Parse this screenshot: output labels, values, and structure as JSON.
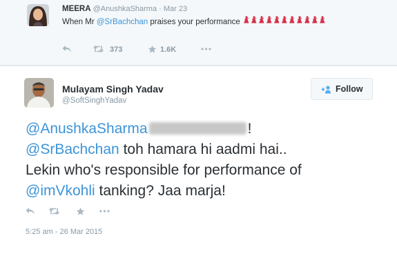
{
  "parent_tweet": {
    "name": "MEERA",
    "handle": "@AnushkaSharma",
    "separator": "·",
    "date": "Mar 23",
    "text_before": "When Mr ",
    "mention": "@SrBachchan",
    "text_after": " praises your performance",
    "emoji_count": 11,
    "emoji_color": "#d6304a",
    "actions": {
      "reply_icon": "reply-icon",
      "retweet_icon": "retweet-icon",
      "retweet_count": "373",
      "favorite_icon": "star-icon",
      "favorite_count": "1.6K",
      "more_icon": "more-icon"
    }
  },
  "main_tweet": {
    "author_name": "Mulayam Singh Yadav",
    "author_handle": "@SoftSinghYadav",
    "follow_label": "Follow",
    "mention1": "@AnushkaSharma",
    "after_mention1": "!",
    "mention2": "@SrBachchan",
    "line2_text": " toh hamara hi aadmi hai..",
    "line3_text": "Lekin who's responsible for performance of",
    "mention3": "@imVkohli",
    "line4_text": " tanking? Jaa marja!",
    "timestamp": "5:25 am - 26 Mar 2015",
    "actions": {
      "reply_icon": "reply-icon",
      "retweet_icon": "retweet-icon",
      "favorite_icon": "star-icon",
      "more_icon": "more-icon"
    }
  },
  "colors": {
    "link": "#3b94d9",
    "muted": "#8899a6",
    "icon": "#aab8c2",
    "text": "#292f33",
    "parent_bg": "#f5f8fa"
  }
}
